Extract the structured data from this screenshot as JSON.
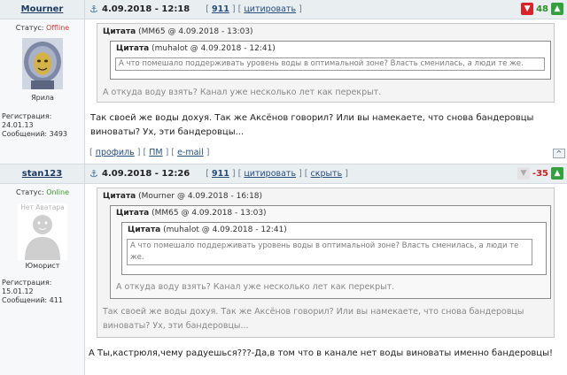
{
  "posts": [
    {
      "author": "Mourner",
      "status_label": "Статус:",
      "status_value": "Offline",
      "avatar_title": "Ярила",
      "reg_label": "Регистрация:",
      "reg_date": "24.01.13",
      "msgs_label": "Сообщений:",
      "msgs_count": "3493",
      "datetime": "4.09.2018 - 12:18",
      "post_num": "911",
      "action_cite": "цитировать",
      "score": "48",
      "quote1_label": "Цитата",
      "quote1_source": "(MM65 @ 4.09.2018 - 13:03)",
      "quote2_label": "Цитата",
      "quote2_source": "(muhalot @ 4.09.2018 - 12:41)",
      "quote2_text": "А что помешало поддерживать уровень воды в оптимальной зоне? Власть сменилась, а люди те же.",
      "quote1_text": "А откуда воду взять? Канал уже несколько лет как перекрыт.",
      "body_line1": "Так своей же воды дохуя. Так же Аксёнов говорил? Или вы намекаете, что снова бандеровцы",
      "body_line2": "виноваты? Ух, эти бандеровцы...",
      "footer_profile": "профиль",
      "footer_pm": "ПМ",
      "footer_email": "e-mail",
      "to_top": "^"
    },
    {
      "author": "stan123",
      "status_label": "Статус:",
      "status_value": "Online",
      "avatar_caption": "Нет Аватара",
      "avatar_title": "Юморист",
      "reg_label": "Регистрация:",
      "reg_date": "15.01.12",
      "msgs_label": "Сообщений:",
      "msgs_count": "411",
      "datetime": "4.09.2018 - 12:26",
      "post_num": "911",
      "action_cite": "цитировать",
      "action_hide": "скрыть",
      "score": "-35",
      "quote1_label": "Цитата",
      "quote1_source": "(Mourner @ 4.09.2018 - 16:18)",
      "quote2_label": "Цитата",
      "quote2_source": "(MM65 @ 4.09.2018 - 13:03)",
      "quote3_label": "Цитата",
      "quote3_source": "(muhalot @ 4.09.2018 - 12:41)",
      "quote3_text_line1": "А что помешало поддерживать уровень воды в оптимальной зоне? Власть сменилась, а люди те",
      "quote3_text_line2": "же.",
      "quote2_text": "А откуда воду взять? Канал уже несколько лет как перекрыт.",
      "quote1_text_line1": "Так своей же воды дохуя. Так же Аксёнов говорил? Или вы намекаете, что снова бандеровцы",
      "quote1_text_line2": "виноваты? Ух, эти бандеровцы...",
      "body_text": "А Ты,кастрюля,чему радуешься???-Да,в том что в канале нет воды виноваты именно бандеровцы!"
    }
  ],
  "icons": {
    "anchor": "anchor-icon",
    "vote_down": "thumbs-down-icon",
    "vote_up": "thumbs-up-icon"
  },
  "colors": {
    "header_bg": "#e9eef1",
    "offline": "#d23b3b",
    "online": "#3a9a2a",
    "post_num": "#c8171a",
    "score_positive": "#2f8f2b",
    "score_negative": "#d21f1f"
  }
}
